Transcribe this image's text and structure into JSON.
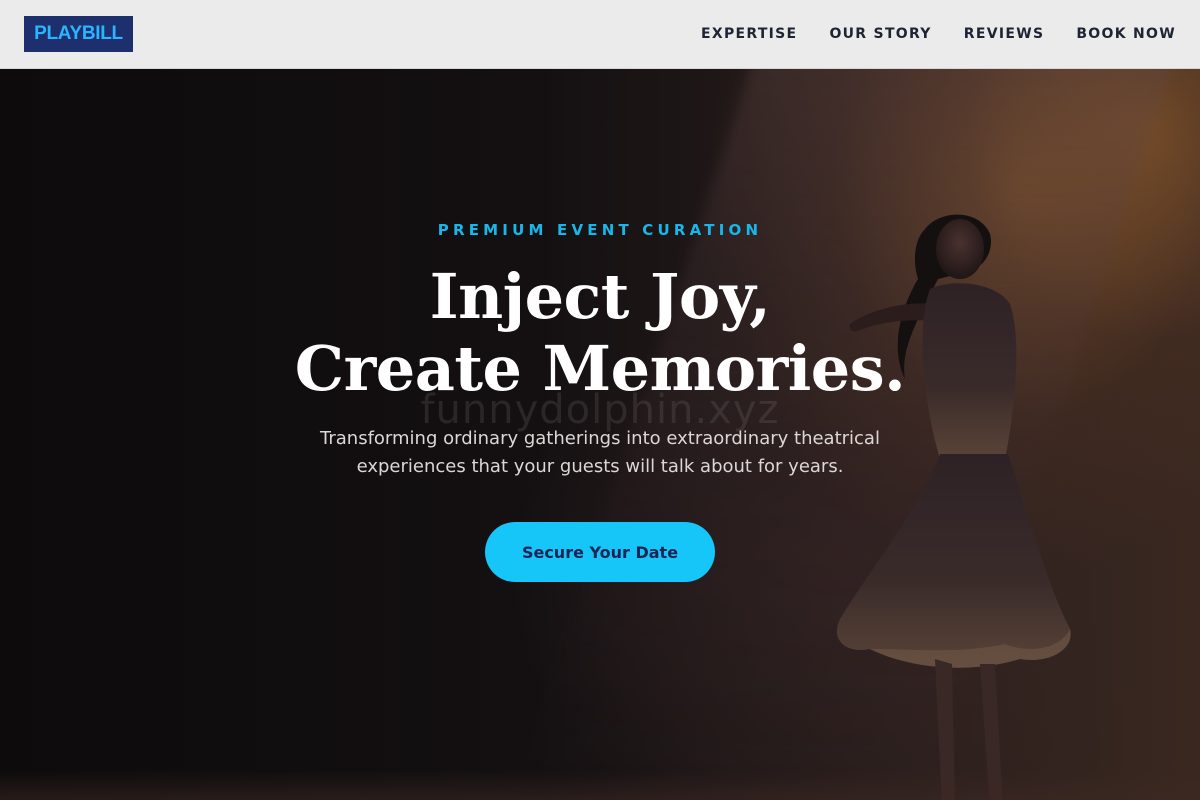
{
  "brand": {
    "logo_text": "PLAYBILL"
  },
  "nav": {
    "items": [
      {
        "label": "EXPERTISE"
      },
      {
        "label": "OUR STORY"
      },
      {
        "label": "REVIEWS"
      },
      {
        "label": "BOOK NOW"
      }
    ]
  },
  "hero": {
    "eyebrow": "PREMIUM EVENT CURATION",
    "headline_line1": "Inject Joy,",
    "headline_line2": "Create Memories.",
    "watermark": "funnydolphin.xyz",
    "subtitle": "Transforming ordinary gatherings into extraordinary theatrical experiences that your guests will talk about for years.",
    "cta_label": "Secure Your Date"
  },
  "colors": {
    "logo_bg": "#1e2f6e",
    "logo_text": "#29b6ff",
    "accent": "#16c6f8",
    "eyebrow": "#16b8ec",
    "cta_text": "#1a2454",
    "header_bg": "#ebebeb"
  },
  "icons": {
    "hero_image": "dancer-on-stage-photo"
  }
}
